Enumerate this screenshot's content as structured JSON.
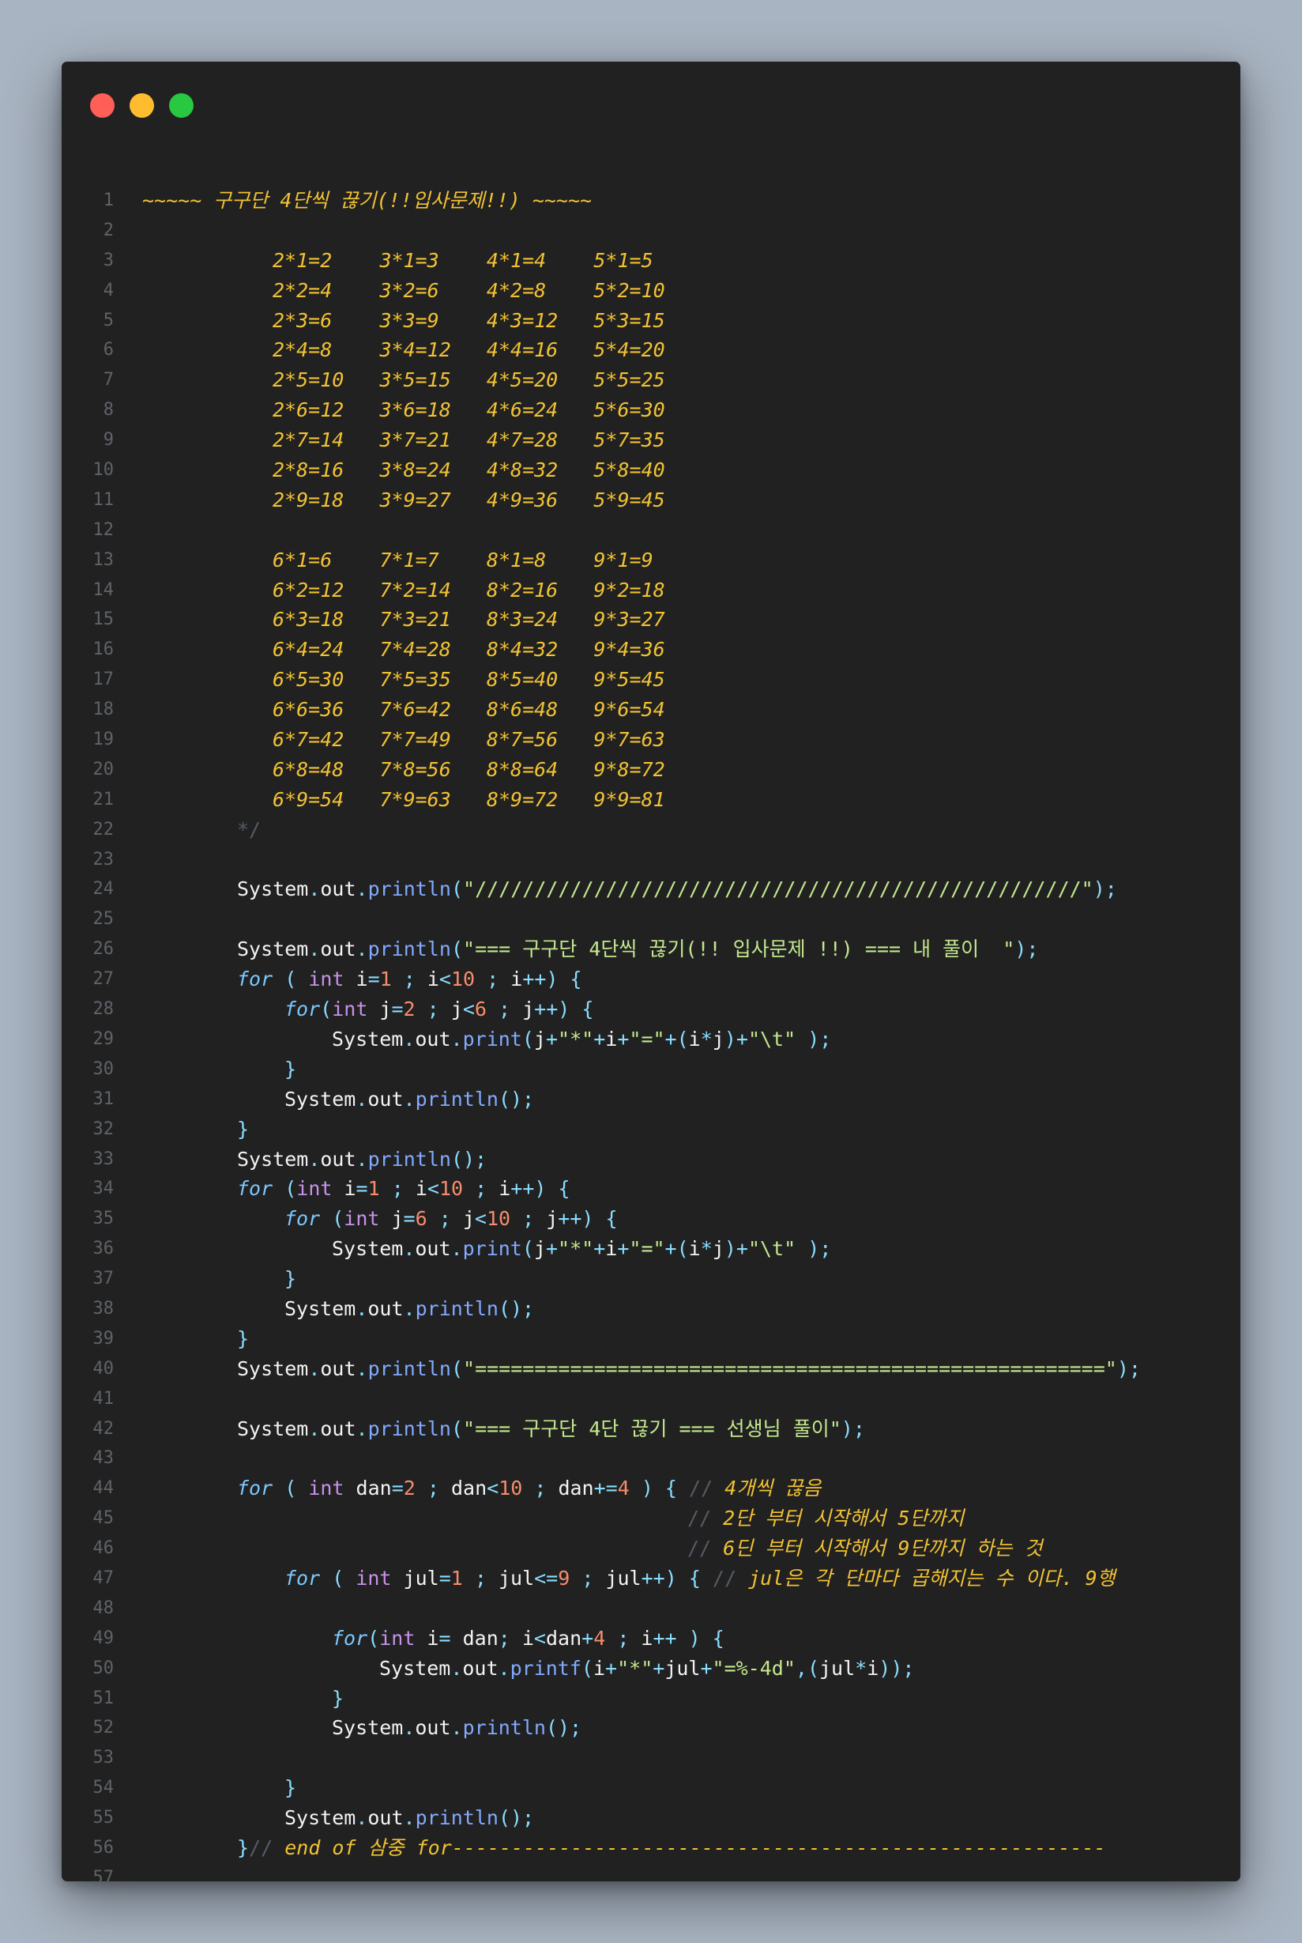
{
  "window_controls": [
    "close",
    "minimize",
    "maximize"
  ],
  "code_lines": [
    {
      "n": "1",
      "i": 0,
      "t": [
        [
          "cm",
          "~~~~~ 구구단 4단씩 끊기(!!입사문제!!) ~~~~~"
        ]
      ]
    },
    {
      "n": "2",
      "i": 0,
      "t": []
    },
    {
      "n": "3",
      "i": 11,
      "t": [
        [
          "cm",
          "2*1=2    3*1=3    4*1=4    5*1=5"
        ]
      ]
    },
    {
      "n": "4",
      "i": 11,
      "t": [
        [
          "cm",
          "2*2=4    3*2=6    4*2=8    5*2=10"
        ]
      ]
    },
    {
      "n": "5",
      "i": 11,
      "t": [
        [
          "cm",
          "2*3=6    3*3=9    4*3=12   5*3=15"
        ]
      ]
    },
    {
      "n": "6",
      "i": 11,
      "t": [
        [
          "cm",
          "2*4=8    3*4=12   4*4=16   5*4=20"
        ]
      ]
    },
    {
      "n": "7",
      "i": 11,
      "t": [
        [
          "cm",
          "2*5=10   3*5=15   4*5=20   5*5=25"
        ]
      ]
    },
    {
      "n": "8",
      "i": 11,
      "t": [
        [
          "cm",
          "2*6=12   3*6=18   4*6=24   5*6=30"
        ]
      ]
    },
    {
      "n": "9",
      "i": 11,
      "t": [
        [
          "cm",
          "2*7=14   3*7=21   4*7=28   5*7=35"
        ]
      ]
    },
    {
      "n": "10",
      "i": 11,
      "t": [
        [
          "cm",
          "2*8=16   3*8=24   4*8=32   5*8=40"
        ]
      ]
    },
    {
      "n": "11",
      "i": 11,
      "t": [
        [
          "cm",
          "2*9=18   3*9=27   4*9=36   5*9=45"
        ]
      ]
    },
    {
      "n": "12",
      "i": 0,
      "t": []
    },
    {
      "n": "13",
      "i": 11,
      "t": [
        [
          "cm",
          "6*1=6    7*1=7    8*1=8    9*1=9"
        ]
      ]
    },
    {
      "n": "14",
      "i": 11,
      "t": [
        [
          "cm",
          "6*2=12   7*2=14   8*2=16   9*2=18"
        ]
      ]
    },
    {
      "n": "15",
      "i": 11,
      "t": [
        [
          "cm",
          "6*3=18   7*3=21   8*3=24   9*3=27"
        ]
      ]
    },
    {
      "n": "16",
      "i": 11,
      "t": [
        [
          "cm",
          "6*4=24   7*4=28   8*4=32   9*4=36"
        ]
      ]
    },
    {
      "n": "17",
      "i": 11,
      "t": [
        [
          "cm",
          "6*5=30   7*5=35   8*5=40   9*5=45"
        ]
      ]
    },
    {
      "n": "18",
      "i": 11,
      "t": [
        [
          "cm",
          "6*6=36   7*6=42   8*6=48   9*6=54"
        ]
      ]
    },
    {
      "n": "19",
      "i": 11,
      "t": [
        [
          "cm",
          "6*7=42   7*7=49   8*7=56   9*7=63"
        ]
      ]
    },
    {
      "n": "20",
      "i": 11,
      "t": [
        [
          "cm",
          "6*8=48   7*8=56   8*8=64   9*8=72"
        ]
      ]
    },
    {
      "n": "21",
      "i": 11,
      "t": [
        [
          "cm",
          "6*9=54   7*9=63   8*9=72   9*9=81"
        ]
      ]
    },
    {
      "n": "22",
      "i": 8,
      "t": [
        [
          "cmd",
          "*/"
        ]
      ]
    },
    {
      "n": "23",
      "i": 0,
      "t": []
    },
    {
      "n": "24",
      "i": 8,
      "t": [
        [
          "pl",
          "System"
        ],
        [
          "op",
          "."
        ],
        [
          "pl",
          "out"
        ],
        [
          "op",
          "."
        ],
        [
          "fn",
          "println"
        ],
        [
          "op",
          "("
        ],
        [
          "st",
          "\"///////////////////////////////////////////////////\""
        ],
        [
          "op",
          ");"
        ]
      ]
    },
    {
      "n": "25",
      "i": 0,
      "t": []
    },
    {
      "n": "26",
      "i": 8,
      "t": [
        [
          "pl",
          "System"
        ],
        [
          "op",
          "."
        ],
        [
          "pl",
          "out"
        ],
        [
          "op",
          "."
        ],
        [
          "fn",
          "println"
        ],
        [
          "op",
          "("
        ],
        [
          "st",
          "\"=== 구구단 4단씩 끊기(!! 입사문제 !!) === 내 풀이  \""
        ],
        [
          "op",
          ");"
        ]
      ]
    },
    {
      "n": "27",
      "i": 8,
      "t": [
        [
          "kw",
          "for"
        ],
        [
          "op",
          " ( "
        ],
        [
          "ty",
          "int"
        ],
        [
          "pl",
          " i"
        ],
        [
          "op",
          "="
        ],
        [
          "nm",
          "1"
        ],
        [
          "op",
          " ; "
        ],
        [
          "pl",
          "i"
        ],
        [
          "op",
          "<"
        ],
        [
          "nm",
          "10"
        ],
        [
          "op",
          " ; "
        ],
        [
          "pl",
          "i"
        ],
        [
          "op",
          "++) {"
        ]
      ]
    },
    {
      "n": "28",
      "i": 12,
      "t": [
        [
          "kw",
          "for"
        ],
        [
          "op",
          "("
        ],
        [
          "ty",
          "int"
        ],
        [
          "pl",
          " j"
        ],
        [
          "op",
          "="
        ],
        [
          "nm",
          "2"
        ],
        [
          "op",
          " ; "
        ],
        [
          "pl",
          "j"
        ],
        [
          "op",
          "<"
        ],
        [
          "nm",
          "6"
        ],
        [
          "op",
          " ; "
        ],
        [
          "pl",
          "j"
        ],
        [
          "op",
          "++) {"
        ]
      ]
    },
    {
      "n": "29",
      "i": 16,
      "t": [
        [
          "pl",
          "System"
        ],
        [
          "op",
          "."
        ],
        [
          "pl",
          "out"
        ],
        [
          "op",
          "."
        ],
        [
          "fn",
          "print"
        ],
        [
          "op",
          "("
        ],
        [
          "pl",
          "j"
        ],
        [
          "op",
          "+"
        ],
        [
          "st",
          "\"*\""
        ],
        [
          "op",
          "+"
        ],
        [
          "pl",
          "i"
        ],
        [
          "op",
          "+"
        ],
        [
          "st",
          "\"=\""
        ],
        [
          "op",
          "+("
        ],
        [
          "pl",
          "i"
        ],
        [
          "op",
          "*"
        ],
        [
          "pl",
          "j"
        ],
        [
          "op",
          ")+"
        ],
        [
          "st",
          "\"\\t\""
        ],
        [
          "op",
          " );"
        ]
      ]
    },
    {
      "n": "30",
      "i": 12,
      "t": [
        [
          "op",
          "}"
        ]
      ]
    },
    {
      "n": "31",
      "i": 12,
      "t": [
        [
          "pl",
          "System"
        ],
        [
          "op",
          "."
        ],
        [
          "pl",
          "out"
        ],
        [
          "op",
          "."
        ],
        [
          "fn",
          "println"
        ],
        [
          "op",
          "();"
        ]
      ]
    },
    {
      "n": "32",
      "i": 8,
      "t": [
        [
          "op",
          "}"
        ]
      ]
    },
    {
      "n": "33",
      "i": 8,
      "t": [
        [
          "pl",
          "System"
        ],
        [
          "op",
          "."
        ],
        [
          "pl",
          "out"
        ],
        [
          "op",
          "."
        ],
        [
          "fn",
          "println"
        ],
        [
          "op",
          "();"
        ]
      ]
    },
    {
      "n": "34",
      "i": 8,
      "t": [
        [
          "kw",
          "for"
        ],
        [
          "op",
          " ("
        ],
        [
          "ty",
          "int"
        ],
        [
          "pl",
          " i"
        ],
        [
          "op",
          "="
        ],
        [
          "nm",
          "1"
        ],
        [
          "op",
          " ; "
        ],
        [
          "pl",
          "i"
        ],
        [
          "op",
          "<"
        ],
        [
          "nm",
          "10"
        ],
        [
          "op",
          " ; "
        ],
        [
          "pl",
          "i"
        ],
        [
          "op",
          "++) {"
        ]
      ]
    },
    {
      "n": "35",
      "i": 12,
      "t": [
        [
          "kw",
          "for"
        ],
        [
          "op",
          " ("
        ],
        [
          "ty",
          "int"
        ],
        [
          "pl",
          " j"
        ],
        [
          "op",
          "="
        ],
        [
          "nm",
          "6"
        ],
        [
          "op",
          " ; "
        ],
        [
          "pl",
          "j"
        ],
        [
          "op",
          "<"
        ],
        [
          "nm",
          "10"
        ],
        [
          "op",
          " ; "
        ],
        [
          "pl",
          "j"
        ],
        [
          "op",
          "++) {"
        ]
      ]
    },
    {
      "n": "36",
      "i": 16,
      "t": [
        [
          "pl",
          "System"
        ],
        [
          "op",
          "."
        ],
        [
          "pl",
          "out"
        ],
        [
          "op",
          "."
        ],
        [
          "fn",
          "print"
        ],
        [
          "op",
          "("
        ],
        [
          "pl",
          "j"
        ],
        [
          "op",
          "+"
        ],
        [
          "st",
          "\"*\""
        ],
        [
          "op",
          "+"
        ],
        [
          "pl",
          "i"
        ],
        [
          "op",
          "+"
        ],
        [
          "st",
          "\"=\""
        ],
        [
          "op",
          "+("
        ],
        [
          "pl",
          "i"
        ],
        [
          "op",
          "*"
        ],
        [
          "pl",
          "j"
        ],
        [
          "op",
          ")+"
        ],
        [
          "st",
          "\"\\t\""
        ],
        [
          "op",
          " );"
        ]
      ]
    },
    {
      "n": "37",
      "i": 12,
      "t": [
        [
          "op",
          "}"
        ]
      ]
    },
    {
      "n": "38",
      "i": 12,
      "t": [
        [
          "pl",
          "System"
        ],
        [
          "op",
          "."
        ],
        [
          "pl",
          "out"
        ],
        [
          "op",
          "."
        ],
        [
          "fn",
          "println"
        ],
        [
          "op",
          "();"
        ]
      ]
    },
    {
      "n": "39",
      "i": 8,
      "t": [
        [
          "op",
          "}"
        ]
      ]
    },
    {
      "n": "40",
      "i": 8,
      "t": [
        [
          "pl",
          "System"
        ],
        [
          "op",
          "."
        ],
        [
          "pl",
          "out"
        ],
        [
          "op",
          "."
        ],
        [
          "fn",
          "println"
        ],
        [
          "op",
          "("
        ],
        [
          "st",
          "\"=====================================================\""
        ],
        [
          "op",
          ");"
        ]
      ]
    },
    {
      "n": "41",
      "i": 0,
      "t": []
    },
    {
      "n": "42",
      "i": 8,
      "t": [
        [
          "pl",
          "System"
        ],
        [
          "op",
          "."
        ],
        [
          "pl",
          "out"
        ],
        [
          "op",
          "."
        ],
        [
          "fn",
          "println"
        ],
        [
          "op",
          "("
        ],
        [
          "st",
          "\"=== 구구단 4단 끊기 === 선생님 풀이\""
        ],
        [
          "op",
          ");"
        ]
      ]
    },
    {
      "n": "43",
      "i": 0,
      "t": []
    },
    {
      "n": "44",
      "i": 8,
      "t": [
        [
          "kw",
          "for"
        ],
        [
          "op",
          " ( "
        ],
        [
          "ty",
          "int"
        ],
        [
          "pl",
          " dan"
        ],
        [
          "op",
          "="
        ],
        [
          "nm",
          "2"
        ],
        [
          "op",
          " ; "
        ],
        [
          "pl",
          "dan"
        ],
        [
          "op",
          "<"
        ],
        [
          "nm",
          "10"
        ],
        [
          "op",
          " ; "
        ],
        [
          "pl",
          "dan"
        ],
        [
          "op",
          "+="
        ],
        [
          "nm",
          "4"
        ],
        [
          "op",
          " ) { "
        ],
        [
          "cmd",
          "// "
        ],
        [
          "cm",
          "4개씩 끊음"
        ]
      ]
    },
    {
      "n": "45",
      "i": 46,
      "t": [
        [
          "cmd",
          "// "
        ],
        [
          "cm",
          "2단 부터 시작해서 5단까지"
        ]
      ]
    },
    {
      "n": "46",
      "i": 46,
      "t": [
        [
          "cmd",
          "// "
        ],
        [
          "cm",
          "6딘 부터 시작해서 9단까지 하는 것"
        ]
      ]
    },
    {
      "n": "47",
      "i": 12,
      "t": [
        [
          "kw",
          "for"
        ],
        [
          "op",
          " ( "
        ],
        [
          "ty",
          "int"
        ],
        [
          "pl",
          " jul"
        ],
        [
          "op",
          "="
        ],
        [
          "nm",
          "1"
        ],
        [
          "op",
          " ; "
        ],
        [
          "pl",
          "jul"
        ],
        [
          "op",
          "<="
        ],
        [
          "nm",
          "9"
        ],
        [
          "op",
          " ; "
        ],
        [
          "pl",
          "jul"
        ],
        [
          "op",
          "++) { "
        ],
        [
          "cmd",
          "// "
        ],
        [
          "cm",
          "jul은 각 단마다 곱해지는 수 이다. 9행"
        ]
      ]
    },
    {
      "n": "48",
      "i": 0,
      "t": []
    },
    {
      "n": "49",
      "i": 16,
      "t": [
        [
          "kw",
          "for"
        ],
        [
          "op",
          "("
        ],
        [
          "ty",
          "int"
        ],
        [
          "pl",
          " i"
        ],
        [
          "op",
          "= "
        ],
        [
          "pl",
          "dan"
        ],
        [
          "op",
          "; "
        ],
        [
          "pl",
          "i"
        ],
        [
          "op",
          "<"
        ],
        [
          "pl",
          "dan"
        ],
        [
          "op",
          "+"
        ],
        [
          "nm",
          "4"
        ],
        [
          "op",
          " ; "
        ],
        [
          "pl",
          "i"
        ],
        [
          "op",
          "++ ) {"
        ]
      ]
    },
    {
      "n": "50",
      "i": 20,
      "t": [
        [
          "pl",
          "System"
        ],
        [
          "op",
          "."
        ],
        [
          "pl",
          "out"
        ],
        [
          "op",
          "."
        ],
        [
          "fn",
          "printf"
        ],
        [
          "op",
          "("
        ],
        [
          "pl",
          "i"
        ],
        [
          "op",
          "+"
        ],
        [
          "st",
          "\"*\""
        ],
        [
          "op",
          "+"
        ],
        [
          "pl",
          "jul"
        ],
        [
          "op",
          "+"
        ],
        [
          "st",
          "\"=%-4d\""
        ],
        [
          "op",
          ",("
        ],
        [
          "pl",
          "jul"
        ],
        [
          "op",
          "*"
        ],
        [
          "pl",
          "i"
        ],
        [
          "op",
          "));"
        ]
      ]
    },
    {
      "n": "51",
      "i": 16,
      "t": [
        [
          "op",
          "}"
        ]
      ]
    },
    {
      "n": "52",
      "i": 16,
      "t": [
        [
          "pl",
          "System"
        ],
        [
          "op",
          "."
        ],
        [
          "pl",
          "out"
        ],
        [
          "op",
          "."
        ],
        [
          "fn",
          "println"
        ],
        [
          "op",
          "();"
        ]
      ]
    },
    {
      "n": "53",
      "i": 0,
      "t": []
    },
    {
      "n": "54",
      "i": 12,
      "t": [
        [
          "op",
          "}"
        ]
      ]
    },
    {
      "n": "55",
      "i": 12,
      "t": [
        [
          "pl",
          "System"
        ],
        [
          "op",
          "."
        ],
        [
          "pl",
          "out"
        ],
        [
          "op",
          "."
        ],
        [
          "fn",
          "println"
        ],
        [
          "op",
          "();"
        ]
      ]
    },
    {
      "n": "56",
      "i": 8,
      "t": [
        [
          "op",
          "}"
        ],
        [
          "cmd",
          "// "
        ],
        [
          "cm",
          "end of 삼중 for-------------------------------------------------------"
        ]
      ]
    },
    {
      "n": "57",
      "i": 0,
      "t": []
    }
  ]
}
